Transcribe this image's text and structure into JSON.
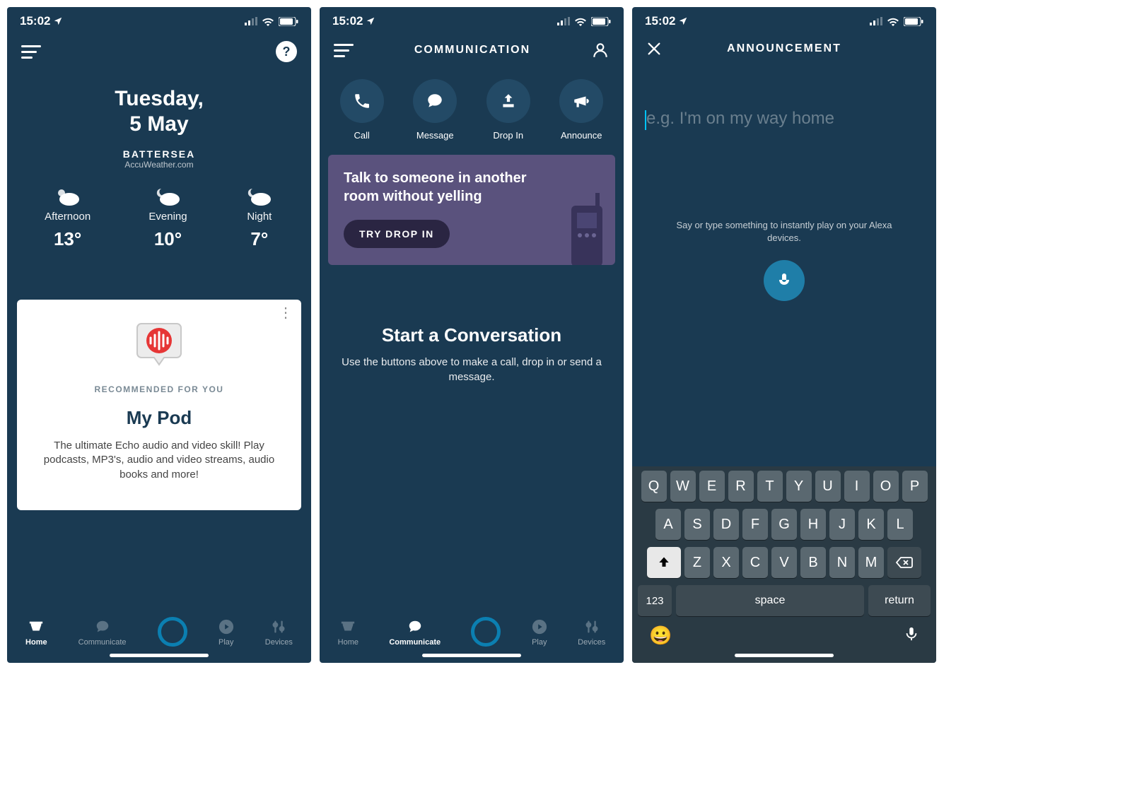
{
  "status": {
    "time": "15:02"
  },
  "screen1": {
    "date_line1": "Tuesday,",
    "date_line2": "5 May",
    "location": "BATTERSEA",
    "source": "AccuWeather.com",
    "weather": [
      {
        "period": "Afternoon",
        "temp": "13°"
      },
      {
        "period": "Evening",
        "temp": "10°"
      },
      {
        "period": "Night",
        "temp": "7°"
      }
    ],
    "card": {
      "rec_label": "RECOMMENDED FOR YOU",
      "title": "My Pod",
      "desc": "The ultimate Echo audio and video skill! Play podcasts, MP3's, audio and video streams, audio books and more!"
    }
  },
  "screen2": {
    "title": "COMMUNICATION",
    "actions": [
      {
        "label": "Call"
      },
      {
        "label": "Message"
      },
      {
        "label": "Drop In"
      },
      {
        "label": "Announce"
      }
    ],
    "promo": {
      "headline": "Talk to someone in another room without yelling",
      "cta": "TRY DROP IN"
    },
    "convo": {
      "heading": "Start a Conversation",
      "sub": "Use the buttons above to make a call, drop in or send a message."
    }
  },
  "screen3": {
    "title": "ANNOUNCEMENT",
    "placeholder": "e.g. I'm on my way home",
    "help": "Say or type something to instantly play on your Alexa devices."
  },
  "tabs": [
    {
      "label": "Home"
    },
    {
      "label": "Communicate"
    },
    {
      "label": ""
    },
    {
      "label": "Play"
    },
    {
      "label": "Devices"
    }
  ],
  "keyboard": {
    "row1": [
      "Q",
      "W",
      "E",
      "R",
      "T",
      "Y",
      "U",
      "I",
      "O",
      "P"
    ],
    "row2": [
      "A",
      "S",
      "D",
      "F",
      "G",
      "H",
      "J",
      "K",
      "L"
    ],
    "row3": [
      "Z",
      "X",
      "C",
      "V",
      "B",
      "N",
      "M"
    ],
    "num": "123",
    "space": "space",
    "ret": "return"
  }
}
